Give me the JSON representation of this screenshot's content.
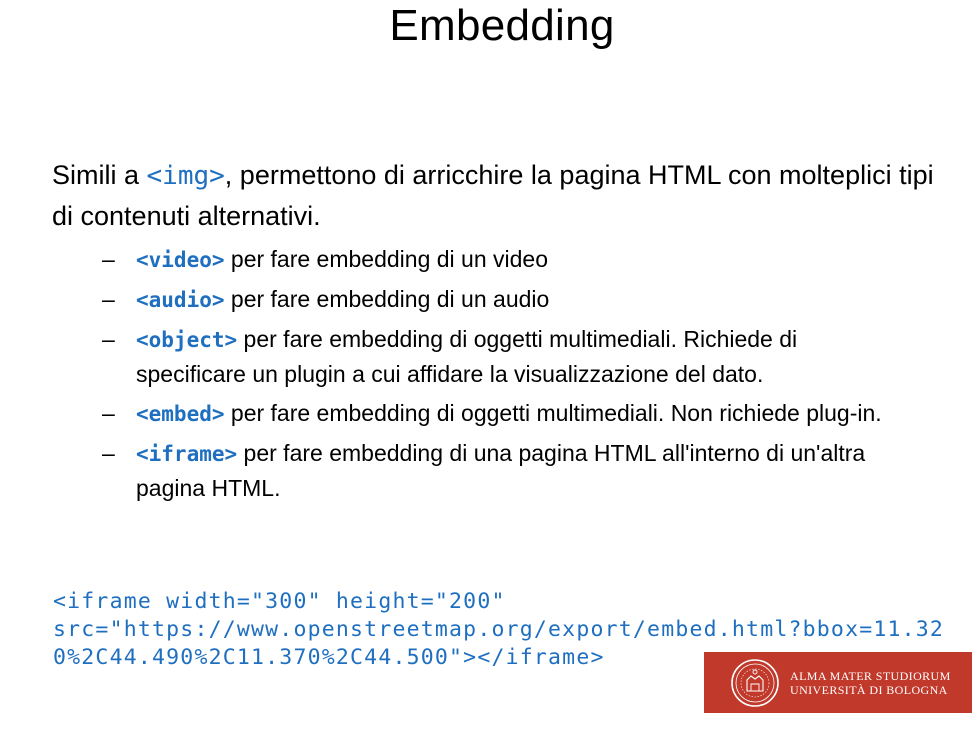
{
  "slide": {
    "title": "Embedding",
    "intro": {
      "before": "Simili a ",
      "code": "<img>",
      "after": ", permettono di arricchire la pagina HTML con molteplici tipi di contenuti alternativi."
    },
    "bullets": [
      {
        "dash": "–",
        "tag": "<video>",
        "text": " per fare embedding di un video"
      },
      {
        "dash": "–",
        "tag": "<audio>",
        "text": " per fare embedding di un audio"
      },
      {
        "dash": "–",
        "tag": "<object>",
        "text": " per fare embedding di oggetti multimediali. Richiede di specificare un plugin a cui affidare la visualizzazione del dato."
      },
      {
        "dash": "–",
        "tag": "<embed>",
        "text": " per fare embedding di oggetti multimediali. Non richiede plug-in."
      },
      {
        "dash": "–",
        "tag": "<iframe>",
        "text": " per fare embedding di una pagina HTML all'interno di un'altra pagina HTML."
      }
    ],
    "code_example": "<iframe width=\"300\" height=\"200\"\nsrc=\"https://www.openstreetmap.org/export/embed.html?bbox=11.320%2C44.490%2C11.370%2C44.500\"></iframe>"
  },
  "logo": {
    "line1": "ALMA MATER STUDIORUM",
    "line2": "UNIVERSITÀ DI BOLOGNA",
    "background": "#c0392b"
  },
  "colors": {
    "code_blue": "#1f6fc0",
    "text": "#000000"
  }
}
